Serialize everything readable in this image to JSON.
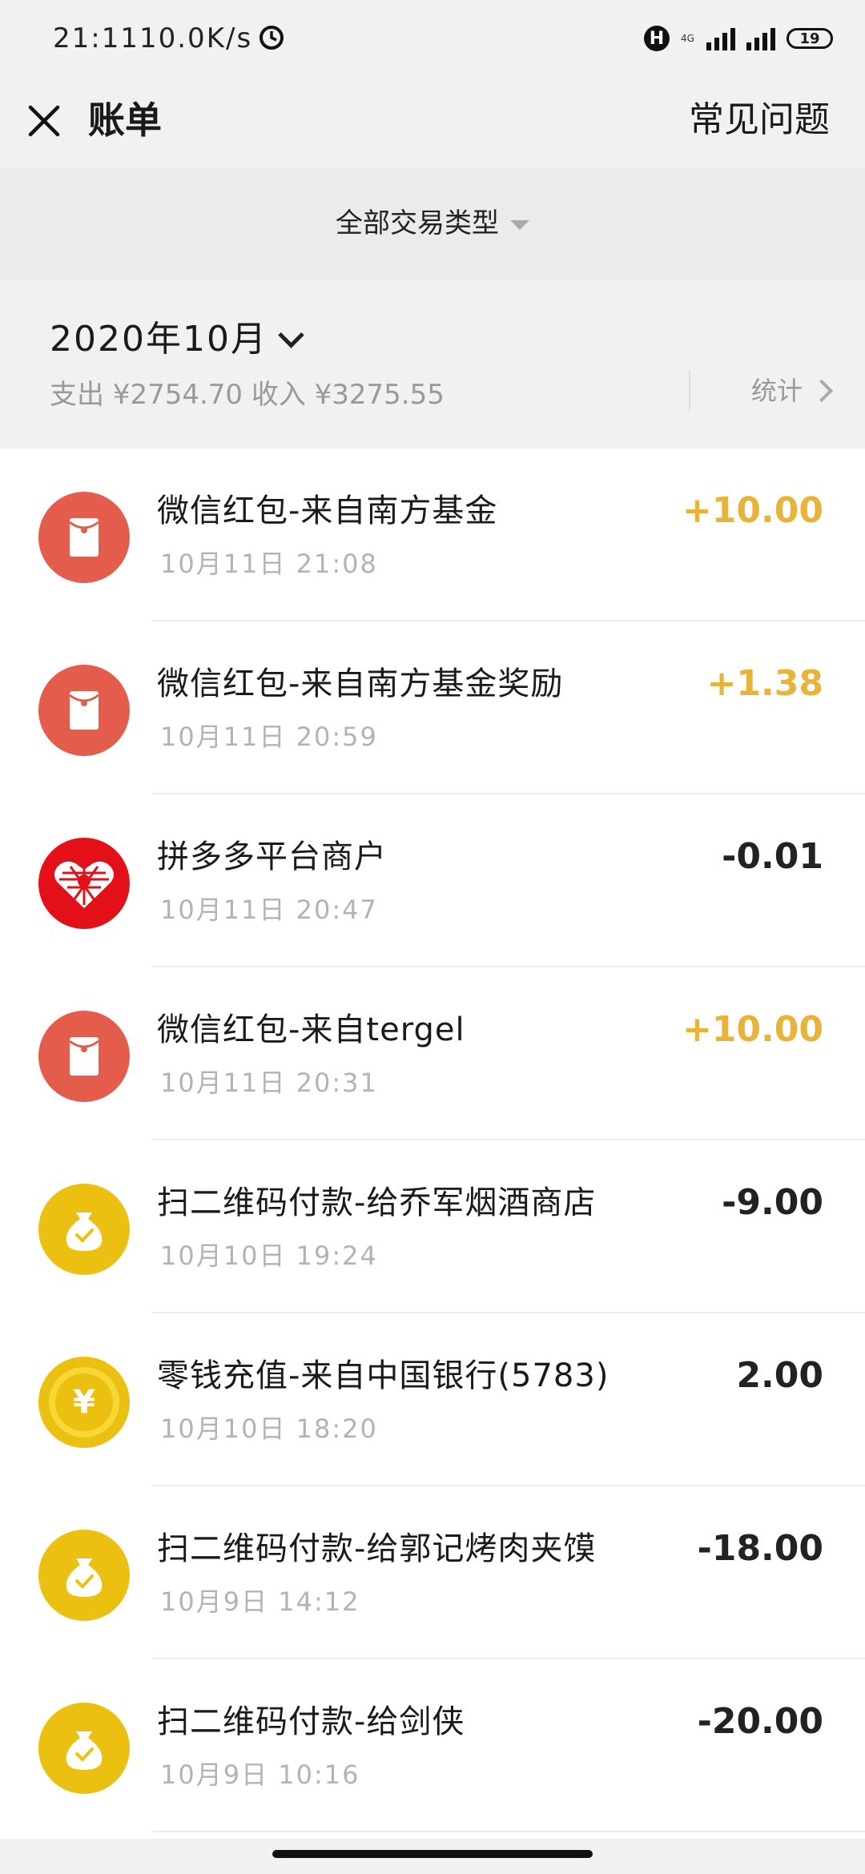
{
  "status_bar": {
    "time": "21:11",
    "speed": "10.0K/s",
    "network": "4G",
    "battery": "19"
  },
  "header": {
    "title": "账单",
    "faq": "常见问题"
  },
  "filter": {
    "label": "全部交易类型"
  },
  "month": {
    "label": "2020年10月",
    "summary": "支出 ¥2754.70 收入 ¥3275.55",
    "stats": "统计"
  },
  "transactions": [
    {
      "name": "微信红包-来自南方基金",
      "time": "10月11日 21:08",
      "amount": "+10.00",
      "icon": "red-packet-icon"
    },
    {
      "name": "微信红包-来自南方基金奖励",
      "time": "10月11日 20:59",
      "amount": "+1.38",
      "icon": "red-packet-icon"
    },
    {
      "name": "拼多多平台商户",
      "time": "10月11日 20:47",
      "amount": "-0.01",
      "icon": "pinduoduo-logo-icon"
    },
    {
      "name": "微信红包-来自tergel",
      "time": "10月11日 20:31",
      "amount": "+10.00",
      "icon": "red-packet-icon"
    },
    {
      "name": "扫二维码付款-给乔军烟酒商店",
      "time": "10月10日 19:24",
      "amount": "-9.00",
      "icon": "money-bag-icon"
    },
    {
      "name": "零钱充值-来自中国银行(5783)",
      "time": "10月10日 18:20",
      "amount": "2.00",
      "icon": "yuan-coin-icon"
    },
    {
      "name": "扫二维码付款-给郭记烤肉夹馍",
      "time": "10月9日 14:12",
      "amount": "-18.00",
      "icon": "money-bag-icon"
    },
    {
      "name": "扫二维码付款-给剑侠",
      "time": "10月9日 10:16",
      "amount": "-20.00",
      "icon": "money-bag-icon"
    }
  ],
  "colors": {
    "income": "#e8b339",
    "expense": "#222222",
    "red_icon": "#e35c4c",
    "gold_icon": "#ecc011"
  }
}
